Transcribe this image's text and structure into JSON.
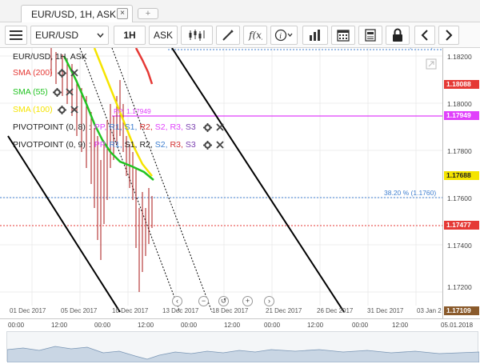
{
  "tab": {
    "label": "EUR/USD, 1H, ASK",
    "close_glyph": "×",
    "add_glyph": "+"
  },
  "toolbar": {
    "symbol": "EUR/USD",
    "period": "1H",
    "side": "ASK",
    "icons": [
      "menu-icon",
      "candles-icon",
      "draw-line-icon",
      "function-icon",
      "info-icon",
      "bar-chart-icon",
      "calendar-icon",
      "report-icon",
      "lock-icon",
      "chevron-left-icon",
      "chevron-right-icon"
    ]
  },
  "chart": {
    "title": "EUR/USD, 1H, ASK",
    "indicators": [
      {
        "label": "SMA (200)",
        "color": "#e53935"
      },
      {
        "label": "SMA (55)",
        "color": "#22c322"
      },
      {
        "label": "SMA (100)",
        "color": "#f5e400"
      }
    ],
    "pivot_rows": [
      {
        "prefix": "PIVOTPOINT (0, 8)",
        "sep": ":",
        "items": [
          {
            "t": "PP",
            "c": "#e040fb"
          },
          {
            "t": "R1",
            "c": "#3f7fd0"
          },
          {
            "t": "S1",
            "c": "#3f7fd0"
          },
          {
            "t": "R2",
            "c": "#d32f2f"
          },
          {
            "t": "S2",
            "c": "#e040fb"
          },
          {
            "t": "R3",
            "c": "#e040fb"
          },
          {
            "t": "S3",
            "c": "#7b3fb0"
          }
        ]
      },
      {
        "prefix": "PIVOTPOINT (0, 9)",
        "sep": ":",
        "items": [
          {
            "t": "PP",
            "c": "#e040fb"
          },
          {
            "t": "R1",
            "c": "#3f7fd0"
          },
          {
            "t": "S1",
            "c": "#222222"
          },
          {
            "t": "R2",
            "c": "#222222"
          },
          {
            "t": "S2",
            "c": "#3f7fd0"
          },
          {
            "t": "R3",
            "c": "#d32f2f"
          },
          {
            "t": "S3",
            "c": "#7b3fb0"
          }
        ]
      }
    ],
    "price_labels": [
      "1.18200",
      "1.18000",
      "1.17800",
      "1.17600",
      "1.17400",
      "1.17200"
    ],
    "price_tags": [
      {
        "text": "1.18088",
        "bg": "#e53935",
        "fg": "#ffffff"
      },
      {
        "text": "1.17949",
        "bg": "#e040fb",
        "fg": "#ffffff"
      },
      {
        "text": "1.17688",
        "bg": "#f5e400",
        "fg": "#222222"
      },
      {
        "text": "1.17477",
        "bg": "#e53935",
        "fg": "#ffffff"
      },
      {
        "text": "1.17109",
        "bg": "#8a5a2b",
        "fg": "#ffffff"
      }
    ],
    "annotations": {
      "pp_label": "PP: 1.17949",
      "fib_top": "50.00 % (1.1803)",
      "fib_382": "38.20 % (1.1760)"
    },
    "dates": [
      "01 Dec 2017",
      "05 Dec 2017",
      "10 Dec 2017",
      "13 Dec 2017",
      "18 Dec 2017",
      "21 Dec 2017",
      "26 Dec 2017",
      "31 Dec 2017",
      "03 Jan 2"
    ]
  },
  "navigator": {
    "ticks": [
      "00:00",
      "12:00",
      "00:00",
      "12:00",
      "00:00",
      "12:00",
      "00:00",
      "12:00",
      "00:00",
      "12:00",
      "05.01.2018"
    ]
  },
  "colors": {
    "accent": "#3f7fd0",
    "grid": "#ececec"
  }
}
